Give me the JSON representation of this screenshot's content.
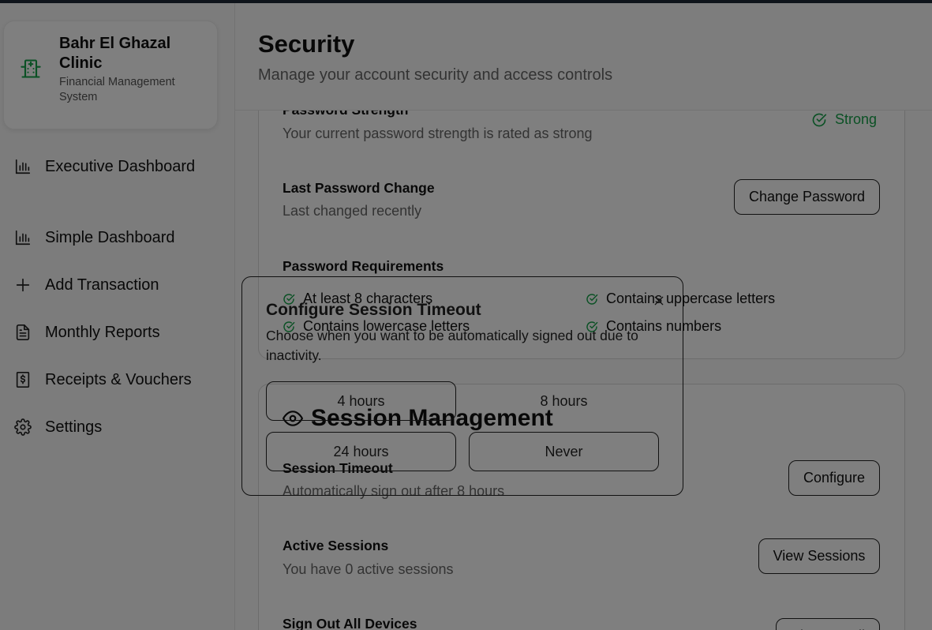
{
  "sidebar": {
    "brand": {
      "name": "Bahr El Ghazal Clinic",
      "subtitle": "Financial Management System",
      "icon": "hospital-icon",
      "accent": "#16a34a"
    },
    "items": [
      {
        "label": "Executive Dashboard",
        "icon": "bar-chart-icon"
      },
      {
        "label": "Simple Dashboard",
        "icon": "bar-chart-icon"
      },
      {
        "label": "Add Transaction",
        "icon": "plus-icon"
      },
      {
        "label": "Monthly Reports",
        "icon": "file-text-icon"
      },
      {
        "label": "Receipts & Vouchers",
        "icon": "receipt-icon"
      },
      {
        "label": "Settings",
        "icon": "gear-icon"
      }
    ]
  },
  "header": {
    "title": "Security",
    "subtitle": "Manage your account security and access controls"
  },
  "password_card": {
    "strength_title": "Password Strength",
    "strength_sub": "Your current password strength is rated as strong",
    "strength_badge": "Strong",
    "strength_color": "#16a34a",
    "last_change_title": "Last Password Change",
    "last_change_sub": "Last changed recently",
    "change_button": "Change Password",
    "requirements_title": "Password Requirements",
    "requirements": [
      "At least 8 characters",
      "Contains uppercase letters",
      "Contains lowercase letters",
      "Contains numbers"
    ]
  },
  "session_card": {
    "heading": "Session Management",
    "timeout_title": "Session Timeout",
    "timeout_sub": "Automatically sign out after 8 hours",
    "configure_button": "Configure",
    "active_title": "Active Sessions",
    "active_sub": "You have 0 active sessions",
    "view_button": "View Sessions",
    "signout_title": "Sign Out All Devices",
    "signout_button": "Sign Out All"
  },
  "dialog": {
    "title": "Configure Session Timeout",
    "description": "Choose when you want to be automatically signed out due to inactivity.",
    "options": [
      "4 hours",
      "8 hours",
      "24 hours",
      "Never"
    ],
    "selected": "8 hours"
  }
}
